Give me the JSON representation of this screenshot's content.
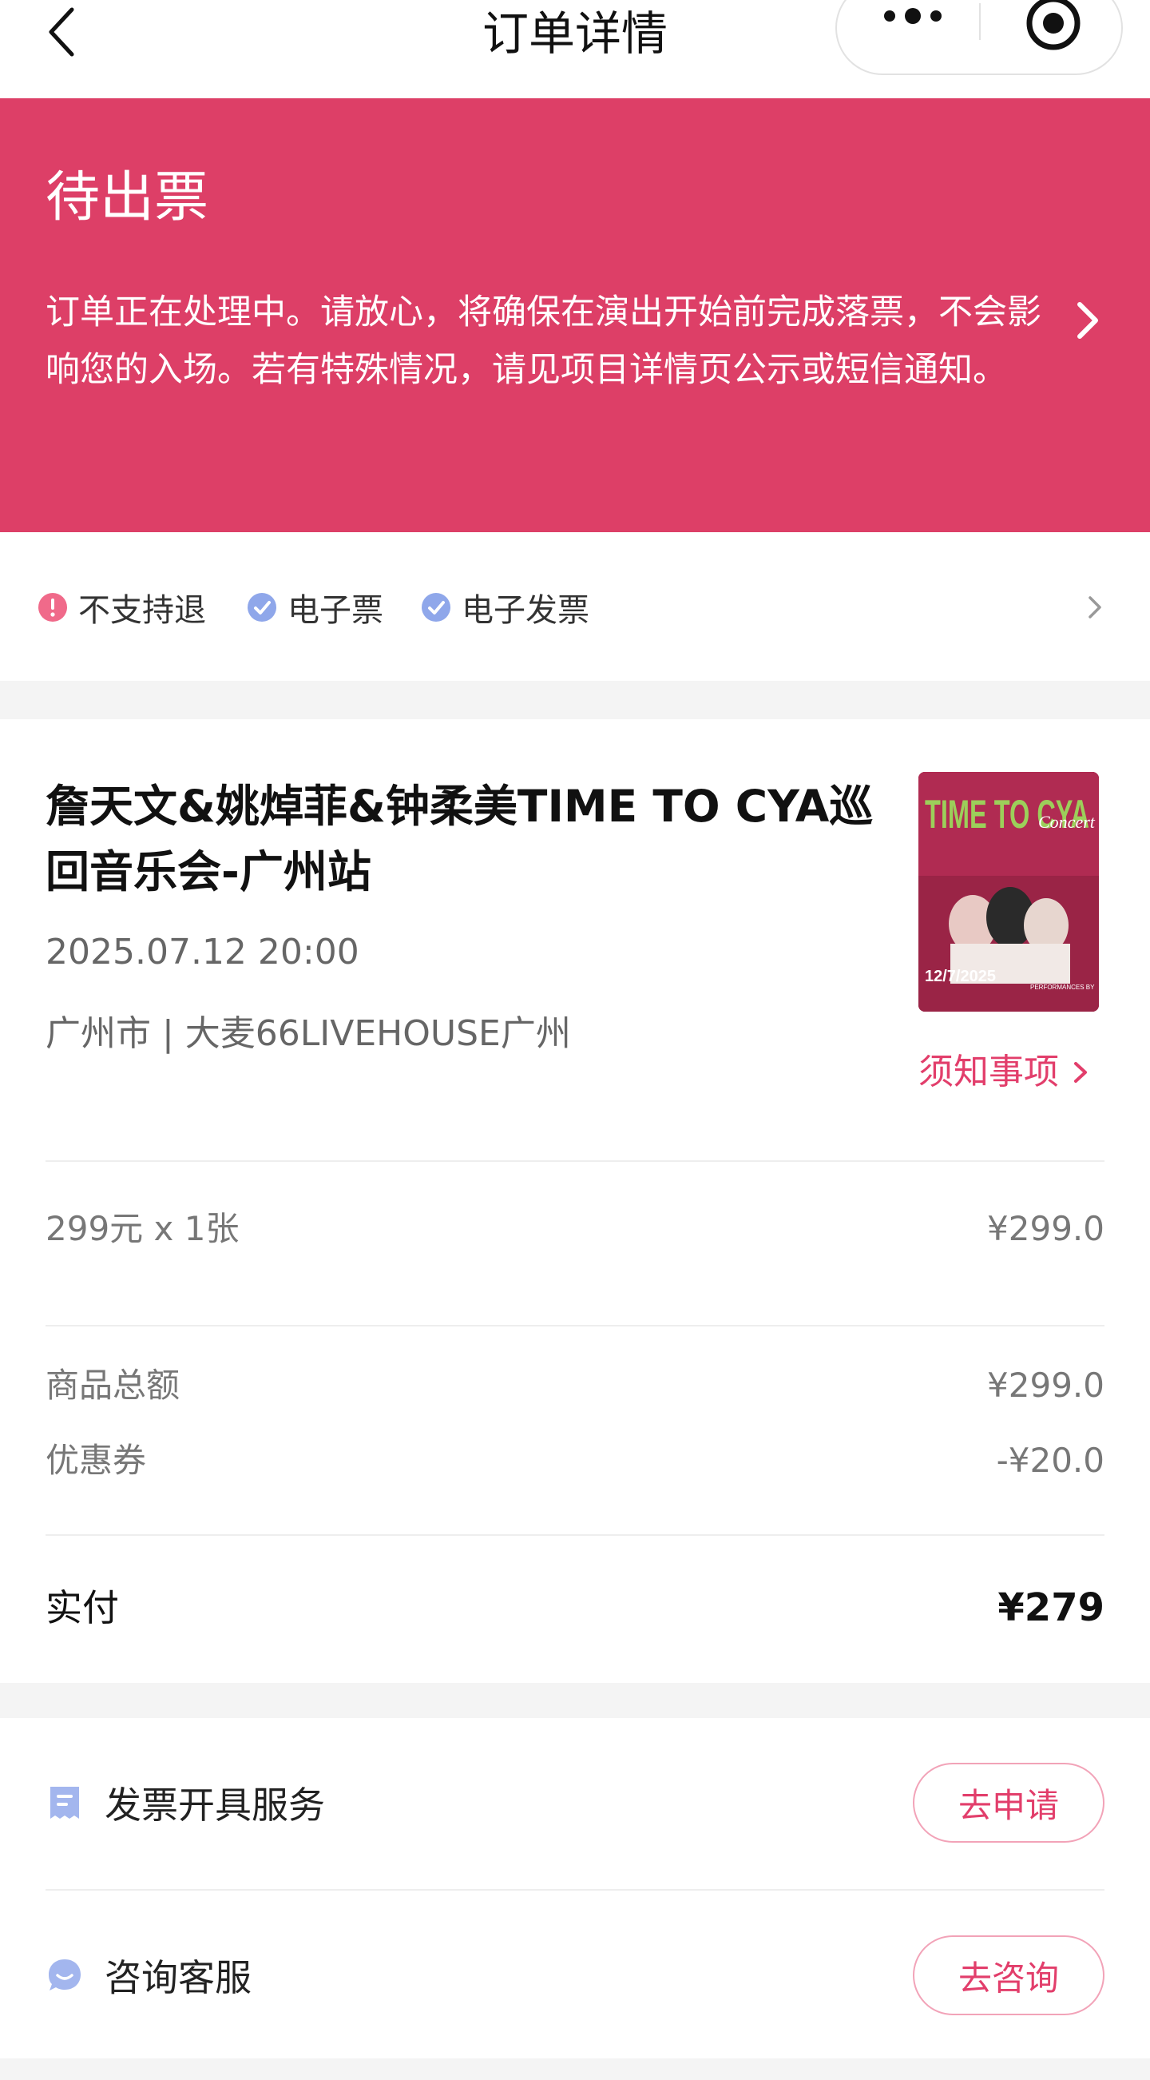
{
  "nav": {
    "title": "订单详情",
    "back_icon": "chevron-left-icon",
    "more_icon": "more-dots-icon",
    "close_icon": "target-icon"
  },
  "status": {
    "title": "待出票",
    "description": "订单正在处理中。请放心，将确保在演出开始前完成落票，不会影响您的入场。若有特殊情况，请见项目详情页公示或短信通知。",
    "background_color": "#dd3f67"
  },
  "tags": [
    {
      "label": "不支持退",
      "icon": "warning-icon"
    },
    {
      "label": "电子票",
      "icon": "check-icon"
    },
    {
      "label": "电子发票",
      "icon": "check-icon"
    }
  ],
  "show": {
    "title": "詹天文&姚焯菲&钟柔美TIME TO CYA巡回音乐会-广州站",
    "time": "2025.07.12 20:00",
    "venue": "广州市 | 大麦66LIVEHOUSE广州",
    "notice_label": "须知事项",
    "poster": {
      "headline": "TIME TO CYA",
      "subhead": "Concert",
      "date": "12/7/2025",
      "credits": "PERFORMANCES BY"
    }
  },
  "ticket_line": {
    "label": "299元 x 1张",
    "amount": "¥299.0"
  },
  "summary": [
    {
      "label": "商品总额",
      "amount": "¥299.0"
    },
    {
      "label": "优惠券",
      "amount": "-¥20.0"
    }
  ],
  "payment": {
    "label": "实付",
    "amount": "¥279"
  },
  "services": [
    {
      "label": "发票开具服务",
      "button": "去申请",
      "icon": "invoice-icon"
    },
    {
      "label": "咨询客服",
      "button": "去咨询",
      "icon": "chat-icon"
    }
  ],
  "colors": {
    "accent": "#e23e6b",
    "check": "#8fa7ea",
    "warn": "#f06a8a"
  }
}
